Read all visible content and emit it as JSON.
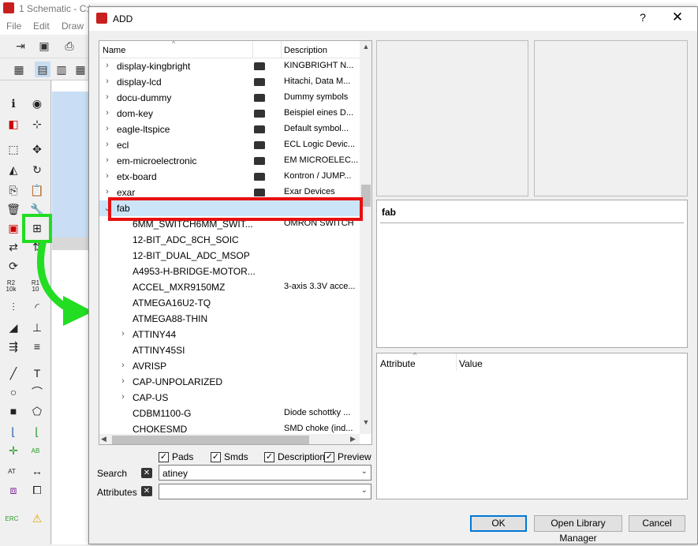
{
  "app": {
    "title": "1 Schematic - C:\\",
    "menu": [
      "File",
      "Edit",
      "Draw"
    ],
    "label_r2": "R2",
    "label_10k": "10k",
    "label_at": "AT",
    "label_erc": "ERC",
    "label_ab": "AB",
    "label_r1": "R1",
    "label_10": "10"
  },
  "dialog": {
    "title": "ADD",
    "help": "?",
    "close": "✕",
    "tree": {
      "col_name": "Name",
      "col_desc": "Description",
      "rows": [
        {
          "name": "display-kingbright",
          "desc": "KINGBRIGHT N...",
          "expander": "›",
          "lib": true
        },
        {
          "name": "display-lcd",
          "desc": "Hitachi, Data M...",
          "expander": "›",
          "lib": true
        },
        {
          "name": "docu-dummy",
          "desc": "Dummy symbols",
          "expander": "›",
          "lib": true
        },
        {
          "name": "dom-key",
          "desc": "Beispiel eines D...",
          "expander": "›",
          "lib": true
        },
        {
          "name": "eagle-ltspice",
          "desc": "Default symbol...",
          "expander": "›",
          "lib": true
        },
        {
          "name": "ecl",
          "desc": "ECL Logic Devic...",
          "expander": "›",
          "lib": true
        },
        {
          "name": "em-microelectronic",
          "desc": "EM MICROELEC...",
          "expander": "›",
          "lib": true
        },
        {
          "name": "etx-board",
          "desc": "Kontron / JUMP...",
          "expander": "›",
          "lib": true
        },
        {
          "name": "exar",
          "desc": "Exar Devices",
          "expander": "›",
          "lib": true
        },
        {
          "name": "fab",
          "desc": "",
          "expander": "⌄",
          "lib": false,
          "selected": true
        },
        {
          "name": "6MM_SWITCH6MM_SWIT...",
          "desc": "OMRON SWITCH",
          "expander": "",
          "lib": false
        },
        {
          "name": "12-BIT_ADC_8CH_SOIC",
          "desc": "",
          "expander": "",
          "lib": false
        },
        {
          "name": "12-BIT_DUAL_ADC_MSOP",
          "desc": "",
          "expander": "",
          "lib": false
        },
        {
          "name": "A4953-H-BRIDGE-MOTOR...",
          "desc": "",
          "expander": "",
          "lib": false
        },
        {
          "name": "ACCEL_MXR9150MZ",
          "desc": "3-axis 3.3V acce...",
          "expander": "",
          "lib": false
        },
        {
          "name": "ATMEGA16U2-TQ",
          "desc": "",
          "expander": "",
          "lib": false
        },
        {
          "name": "ATMEGA88-THIN",
          "desc": "",
          "expander": "",
          "lib": false
        },
        {
          "name": "ATTINY44",
          "desc": "",
          "expander": "›",
          "lib": false
        },
        {
          "name": "ATTINY45SI",
          "desc": "",
          "expander": "",
          "lib": false
        },
        {
          "name": "AVRISP",
          "desc": "",
          "expander": "›",
          "lib": false
        },
        {
          "name": "CAP-UNPOLARIZED",
          "desc": "",
          "expander": "›",
          "lib": false
        },
        {
          "name": "CAP-US",
          "desc": "",
          "expander": "›",
          "lib": false
        },
        {
          "name": "CDBM1100-G",
          "desc": "Diode schottky ...",
          "expander": "",
          "lib": false
        },
        {
          "name": "CHOKESMD",
          "desc": "SMD choke (ind...",
          "expander": "",
          "lib": false
        }
      ]
    },
    "checks": {
      "pads": "Pads",
      "smds": "Smds",
      "description": "Description",
      "preview": "Preview",
      "mark": "✓"
    },
    "search": {
      "label": "Search",
      "value": "atiney",
      "clear": "✕",
      "arrow": "⌄"
    },
    "attributes": {
      "label": "Attributes",
      "value": "",
      "clear": "✕",
      "arrow": "⌄"
    },
    "desc_panel": {
      "title": "fab"
    },
    "attr_table": {
      "col_attr": "Attribute",
      "col_value": "Value"
    },
    "buttons": {
      "ok": "OK",
      "manager": "Open Library Manager",
      "cancel": "Cancel"
    }
  },
  "colors": {
    "selection": "#cce4f7",
    "highlight_red": "#e81010",
    "highlight_green": "#22dd22",
    "primary_border": "#0078d7"
  }
}
